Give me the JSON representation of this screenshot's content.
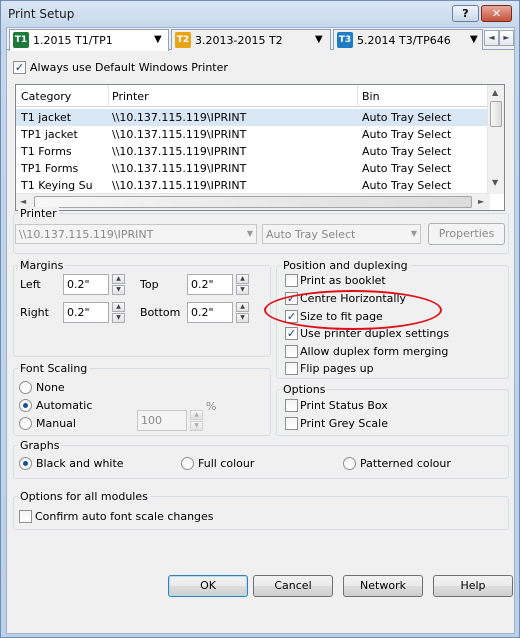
{
  "window": {
    "title": "Print Setup",
    "help_label": "?",
    "close_label": "✕"
  },
  "tabs": [
    {
      "icon": "T1",
      "label": "1.2015 T1/TP1",
      "color": "#1d7a3c"
    },
    {
      "icon": "T2",
      "label": "3.2013-2015 T2",
      "color": "#e8a317"
    },
    {
      "icon": "T3",
      "label": "5.2014 T3/TP646",
      "color": "#1f7cc2"
    }
  ],
  "tab_dropdown_glyph": "▼",
  "tab_scroll": {
    "left": "◄",
    "right": "►"
  },
  "always_default": {
    "label": "Always use Default Windows Printer",
    "checked": true
  },
  "list": {
    "headers": [
      "Category",
      "Printer",
      "Bin"
    ],
    "rows": [
      {
        "category": "T1 jacket",
        "printer": "\\\\10.137.115.119\\IPRINT",
        "bin": "Auto Tray Select",
        "selected": true
      },
      {
        "category": "TP1 jacket",
        "printer": "\\\\10.137.115.119\\IPRINT",
        "bin": "Auto Tray Select",
        "selected": false
      },
      {
        "category": "T1 Forms",
        "printer": "\\\\10.137.115.119\\IPRINT",
        "bin": "Auto Tray Select",
        "selected": false
      },
      {
        "category": "TP1 Forms",
        "printer": "\\\\10.137.115.119\\IPRINT",
        "bin": "Auto Tray Select",
        "selected": false
      },
      {
        "category": "T1 Keying Su",
        "printer": "\\\\10.137.115.119\\IPRINT",
        "bin": "Auto Tray Select",
        "selected": false
      }
    ]
  },
  "printer_group": {
    "label": "Printer",
    "printer_value": "\\\\10.137.115.119\\IPRINT",
    "bin_value": "Auto Tray Select",
    "properties_label": "Properties"
  },
  "margins": {
    "label": "Margins",
    "left_label": "Left",
    "left_value": "0.2\"",
    "top_label": "Top",
    "top_value": "0.2\"",
    "right_label": "Right",
    "right_value": "0.2\"",
    "bottom_label": "Bottom",
    "bottom_value": "0.2\""
  },
  "position": {
    "label": "Position and duplexing",
    "items": [
      {
        "label": "Print as booklet",
        "checked": false
      },
      {
        "label": "Centre Horizontally",
        "checked": true
      },
      {
        "label": "Size to fit page",
        "checked": true
      },
      {
        "label": "Use printer duplex settings",
        "checked": true
      },
      {
        "label": "Allow duplex form merging",
        "checked": false
      },
      {
        "label": "Flip pages up",
        "checked": false
      }
    ]
  },
  "font_scaling": {
    "label": "Font Scaling",
    "none_label": "None",
    "automatic_label": "Automatic",
    "manual_label": "Manual",
    "selected": "Automatic",
    "manual_value": "100",
    "percent": "%"
  },
  "options": {
    "label": "Options",
    "items": [
      {
        "label": "Print Status Box",
        "checked": false
      },
      {
        "label": "Print Grey Scale",
        "checked": false
      }
    ]
  },
  "graphs": {
    "label": "Graphs",
    "bw_label": "Black and white",
    "full_label": "Full colour",
    "pattern_label": "Patterned colour",
    "selected": "Black and white"
  },
  "all_modules": {
    "label": "Options for all modules",
    "confirm_label": "Confirm auto font scale changes",
    "confirm_checked": false
  },
  "buttons": {
    "ok": "OK",
    "cancel": "Cancel",
    "network": "Network",
    "help": "Help"
  },
  "colors": {
    "highlight_circle": "#e0101a",
    "selected_row": "#d9e6f4",
    "default_button": "#3c7fb1"
  }
}
